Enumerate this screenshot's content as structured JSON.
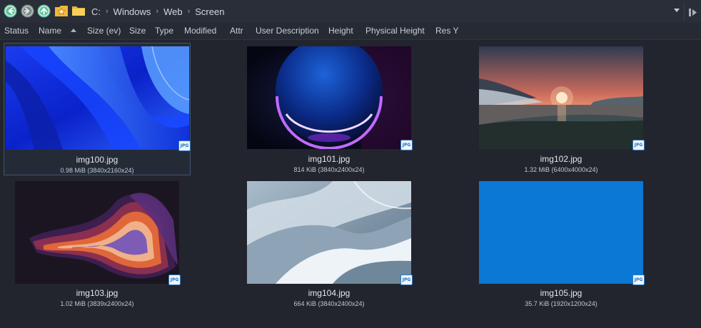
{
  "address_bar": {
    "icons": [
      "back-arrow-icon",
      "forward-arrow-icon",
      "up-arrow-icon",
      "favorites-star-icon",
      "folder-icon"
    ],
    "breadcrumbs": [
      "C:",
      "Windows",
      "Web",
      "Screen"
    ],
    "separator": "›"
  },
  "columns": [
    "Status",
    "Name",
    "Size (ev)",
    "Size",
    "Type",
    "Modified",
    "Attr",
    "User Description",
    "Height",
    "Physical Height",
    "Res Y"
  ],
  "files": [
    {
      "name": "img100.jpg",
      "info": "0.98 MiB (3840x2160x24)",
      "badge": "JPG",
      "selected": true
    },
    {
      "name": "img101.jpg",
      "info": "814 KiB (3840x2400x24)",
      "badge": "JPG",
      "selected": false
    },
    {
      "name": "img102.jpg",
      "info": "1.32 MiB (6400x4000x24)",
      "badge": "JPG",
      "selected": false
    },
    {
      "name": "img103.jpg",
      "info": "1.02 MiB (3839x2400x24)",
      "badge": "JPG",
      "selected": false
    },
    {
      "name": "img104.jpg",
      "info": "664 KiB (3840x2400x24)",
      "badge": "JPG",
      "selected": false
    },
    {
      "name": "img105.jpg",
      "info": "35.7 KiB (1920x1200x24)",
      "badge": "JPG",
      "selected": false
    }
  ],
  "colors": {
    "background": "#22252e",
    "toolbar": "#2a2e38",
    "nav_button": "#5fbf9a",
    "folder": "#f4c84a",
    "selection_border": "#3d5570",
    "img105_fill": "#0a78d4"
  }
}
